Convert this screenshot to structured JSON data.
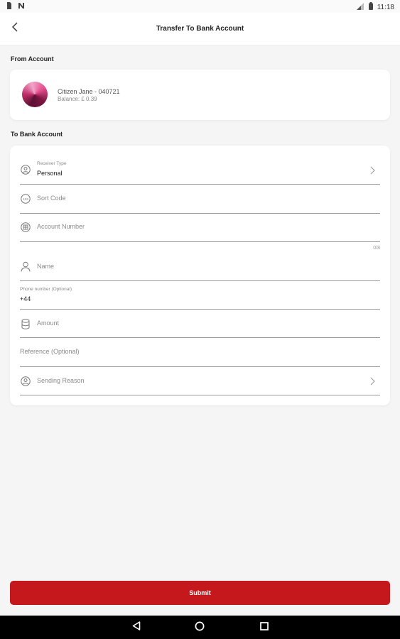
{
  "status_bar": {
    "time": "11:18",
    "icons": [
      "sim-icon",
      "notification-n-icon",
      "signal-icon",
      "battery-icon"
    ]
  },
  "header": {
    "title": "Transfer To Bank Account"
  },
  "from_account": {
    "section_label": "From Account",
    "name": "Citizen Jane - 040721",
    "balance": "Balance: £ 0.39"
  },
  "to_account": {
    "section_label": "To Bank Account",
    "receiver_type_label": "Receiver Type",
    "receiver_type_value": "Personal",
    "sort_code_placeholder": "Sort Code",
    "account_number_placeholder": "Account Number",
    "account_number_counter": "0/8",
    "name_placeholder": "Name",
    "phone_label": "Phone number (Optional)",
    "phone_value": "+44",
    "amount_placeholder": "Amount",
    "reference_placeholder": "Reference (Optional)",
    "sending_reason_placeholder": "Sending Reason"
  },
  "actions": {
    "submit_label": "Submit"
  },
  "colors": {
    "accent": "#c5181c",
    "background": "#f5f5f5"
  }
}
